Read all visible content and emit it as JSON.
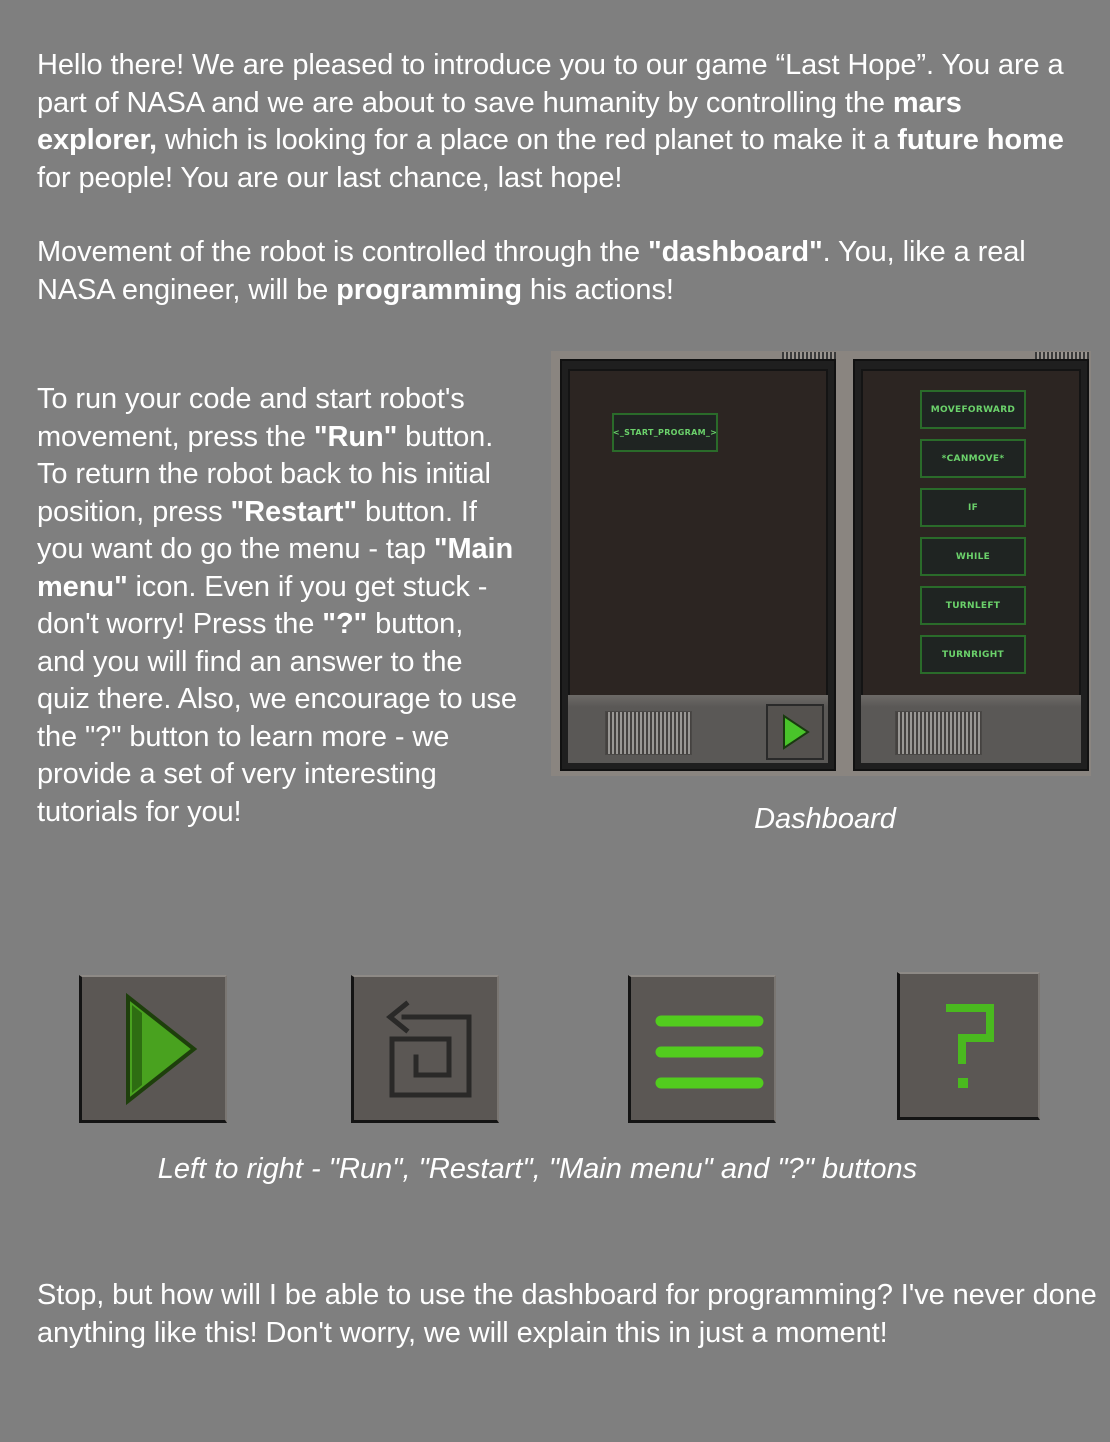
{
  "intro": {
    "t1": "Hello there! We are pleased to introduce you to our game “Last Hope”. You are a part of NASA and we are about to save humanity by controlling the ",
    "b1": "mars explorer,",
    "t2": " which is looking for a place on the red planet to make it a ",
    "b2": "future home",
    "t3": " for people! You are our last chance, last hope!"
  },
  "movement": {
    "t1": "Movement of the robot is controlled through the ",
    "b1": "\"dashboard\"",
    "t2": ". You, like a real NASA engineer, will be ",
    "b2": "programming",
    "t3": " his actions!"
  },
  "controls": {
    "t1": "To run your code and start robot's movement, press the ",
    "b1": "\"Run\"",
    "t2": " button. To return the robot back to his initial position, press ",
    "b2": "\"Restart\"",
    "t3": " button. If you want do go the menu - tap ",
    "b3": "\"Main menu\"",
    "t4": " icon. Even if you get stuck - don't worry! Press the ",
    "b4": "\"?\"",
    "t5": " button, and you will find an answer to the quiz there. Also, we encourage to use the \"?\"  button to learn more - we provide a set of very interesting tutorials  for you!"
  },
  "dashboard": {
    "caption": "Dashboard",
    "program_block": "<_START_PROGRAM_>",
    "menu_blocks": [
      "MOVEFORWARD",
      "*CANMOVE*",
      "IF",
      "WHILE",
      "TURNLEFT",
      "TURNRIGHT"
    ]
  },
  "buttons": {
    "caption": "Left to right - \"Run\", \"Restart\", \"Main menu\" and \"?\" buttons",
    "icons": [
      "play-icon",
      "restart-icon",
      "menu-icon",
      "question-icon"
    ],
    "accent_color": "#49c42a"
  },
  "outro": {
    "text": "Stop, but how will I be able to use the dashboard for programming? I've never done anything like this! Don't worry, we will explain this in just a moment!"
  }
}
